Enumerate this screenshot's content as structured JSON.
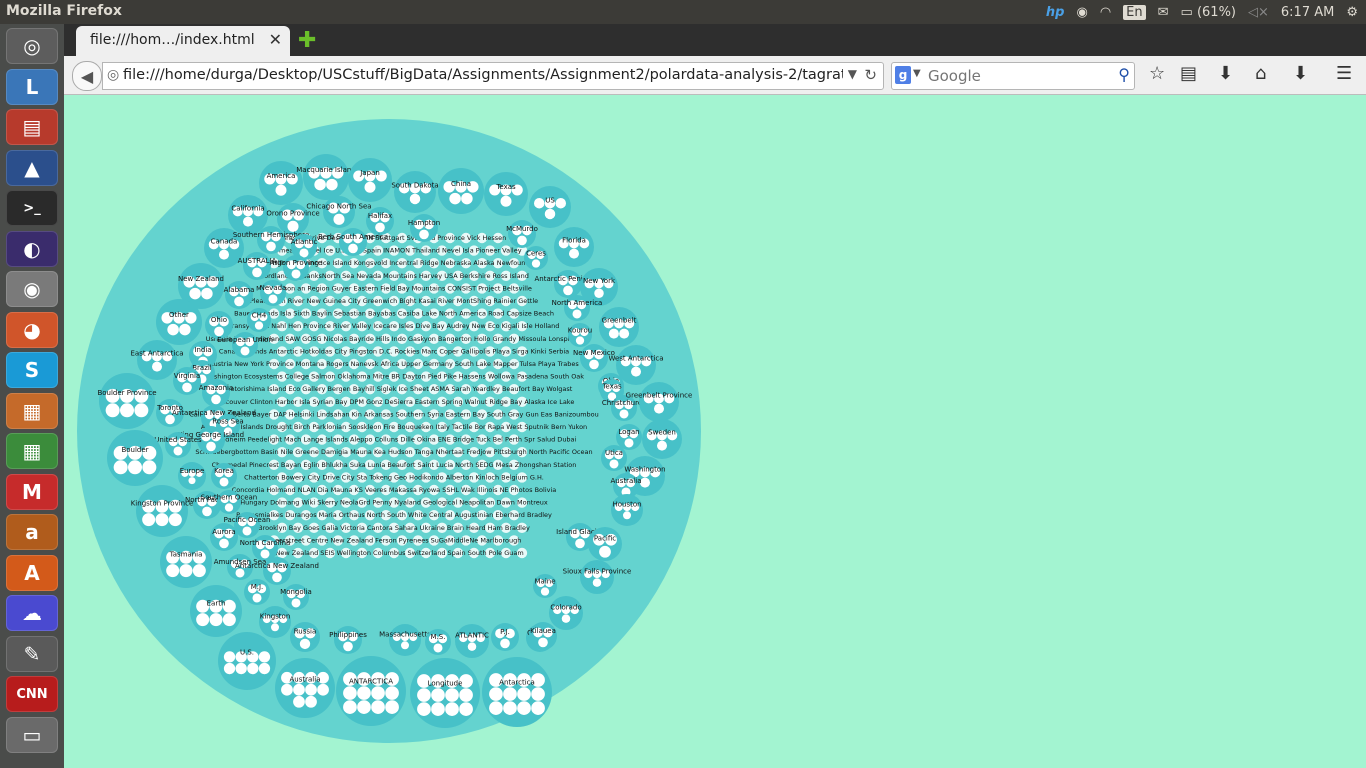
{
  "os": {
    "window_title": "Mozilla Firefox",
    "keyboard": "En",
    "battery": "(61%)",
    "clock": "6:17 AM"
  },
  "launcher": [
    {
      "name": "ubuntu-dash-icon",
      "glyph": "◎",
      "color": "#5d5d5d"
    },
    {
      "name": "libreoffice-icon",
      "glyph": "L",
      "color": "#3a76b8"
    },
    {
      "name": "files-icon",
      "glyph": "▤",
      "color": "#b73a2c"
    },
    {
      "name": "matlab-icon",
      "glyph": "▲",
      "color": "#2b4f8c"
    },
    {
      "name": "terminal-icon",
      "glyph": ">_",
      "color": "#2a2a2a"
    },
    {
      "name": "eclipse-icon",
      "glyph": "◐",
      "color": "#3a2c6c"
    },
    {
      "name": "chrome-icon",
      "glyph": "◉",
      "color": "#7a7a7a"
    },
    {
      "name": "firefox-icon",
      "glyph": "◕",
      "color": "#d0552a"
    },
    {
      "name": "skype-icon",
      "glyph": "S",
      "color": "#1a9ad6"
    },
    {
      "name": "impress-icon",
      "glyph": "▦",
      "color": "#c56a2a"
    },
    {
      "name": "calc-icon",
      "glyph": "▦",
      "color": "#3b8c3b"
    },
    {
      "name": "gmail-icon",
      "glyph": "M",
      "color": "#c62b2b"
    },
    {
      "name": "amazon-icon",
      "glyph": "a",
      "color": "#b05c1c"
    },
    {
      "name": "software-center-icon",
      "glyph": "A",
      "color": "#d35a1a"
    },
    {
      "name": "weather-icon",
      "glyph": "☁",
      "color": "#4a4ad0"
    },
    {
      "name": "viewer-icon",
      "glyph": "✎",
      "color": "#5a5a5a"
    },
    {
      "name": "cnn-icon",
      "glyph": "CNN",
      "color": "#b71c1c"
    },
    {
      "name": "disk-icon",
      "glyph": "▭",
      "color": "#6a6a6a"
    }
  ],
  "browser": {
    "tab_title": "file:///hom…/index.html",
    "url": "file:///home/durga/Desktop/USCstuff/BigData/Assignments/Assignment2/polardata-analysis-2/tagratio/ind",
    "search_placeholder": "Google"
  },
  "viz": {
    "nodes": [
      {
        "label": "America",
        "n": 4
      },
      {
        "label": "Macquarie Island",
        "n": 5
      },
      {
        "label": "Japan",
        "n": 4
      },
      {
        "label": "South Dakota",
        "n": 4
      },
      {
        "label": "China",
        "n": 5
      },
      {
        "label": "Texas",
        "n": 4
      },
      {
        "label": "US",
        "n": 4
      },
      {
        "label": "California",
        "n": 4
      },
      {
        "label": "Orono Province",
        "n": 3
      },
      {
        "label": "Chicago North Sea",
        "n": 3
      },
      {
        "label": "Halifax",
        "n": 3
      },
      {
        "label": "Hampton",
        "n": 3
      },
      {
        "label": "McMurdo",
        "n": 3
      },
      {
        "label": "Florida",
        "n": 4
      },
      {
        "label": "Canada",
        "n": 4
      },
      {
        "label": "Southern Hemisphere",
        "n": 3
      },
      {
        "label": "Atlantic",
        "n": 3
      },
      {
        "label": "Berb South America",
        "n": 3
      },
      {
        "label": "Ceres",
        "n": 3
      },
      {
        "label": "AUSTRALIA",
        "n": 3
      },
      {
        "label": "Argon Province",
        "n": 3
      },
      {
        "label": "New Zealand",
        "n": 5
      },
      {
        "label": "Alabama",
        "n": 3
      },
      {
        "label": "Nevada",
        "n": 3
      },
      {
        "label": "Antarctic Peninsula",
        "n": 3
      },
      {
        "label": "New York",
        "n": 4
      },
      {
        "label": "North America",
        "n": 3
      },
      {
        "label": "Other",
        "n": 5
      },
      {
        "label": "Ohio",
        "n": 3
      },
      {
        "label": "CH4",
        "n": 3
      },
      {
        "label": "Greenbelt",
        "n": 5
      },
      {
        "label": "Kourou",
        "n": 3
      },
      {
        "label": "European Union",
        "n": 3
      },
      {
        "label": "East Antarctica",
        "n": 4
      },
      {
        "label": "India",
        "n": 3
      },
      {
        "label": "New Mexico",
        "n": 3
      },
      {
        "label": "West Antarctica",
        "n": 4
      },
      {
        "label": "Brazil",
        "n": 3
      },
      {
        "label": "Virginia",
        "n": 3
      },
      {
        "label": "Amazonia",
        "n": 3
      },
      {
        "label": "Boulder Province",
        "n": 6
      },
      {
        "label": "Toronto",
        "n": 3
      },
      {
        "label": "Antarctica New Zealand",
        "n": 3
      },
      {
        "label": "Ross Sea",
        "n": 3
      },
      {
        "label": "Ohio",
        "n": 3
      },
      {
        "label": "Texas",
        "n": 3
      },
      {
        "label": "Christchurch",
        "n": 3
      },
      {
        "label": "Greenbelt Province",
        "n": 4
      },
      {
        "label": "King George Island",
        "n": 3
      },
      {
        "label": "United States",
        "n": 3
      },
      {
        "label": "Logan",
        "n": 3
      },
      {
        "label": "Sweden",
        "n": 4
      },
      {
        "label": "Boulder",
        "n": 6
      },
      {
        "label": "Utica",
        "n": 3
      },
      {
        "label": "Europe",
        "n": 4
      },
      {
        "label": "Korea",
        "n": 3
      },
      {
        "label": "Washington",
        "n": 4
      },
      {
        "label": "Australia",
        "n": 3
      },
      {
        "label": "Kingston Province",
        "n": 6
      },
      {
        "label": "North Pacific",
        "n": 3
      },
      {
        "label": "Southern Ocean",
        "n": 3
      },
      {
        "label": "Houston",
        "n": 4
      },
      {
        "label": "Aurora",
        "n": 3
      },
      {
        "label": "Pacific Ocean",
        "n": 3
      },
      {
        "label": "North Carolina",
        "n": 3
      },
      {
        "label": "Island Glacier",
        "n": 3
      },
      {
        "label": "Pacific",
        "n": 3
      },
      {
        "label": "Tasmania",
        "n": 6
      },
      {
        "label": "Amundsen Sea",
        "n": 3
      },
      {
        "label": "Antarctica New Zealand",
        "n": 3
      },
      {
        "label": "Sioux Falls Province",
        "n": 4
      },
      {
        "label": "Mongolia",
        "n": 3
      },
      {
        "label": "M.J.",
        "n": 3
      },
      {
        "label": "Maine",
        "n": 3
      },
      {
        "label": "Earth",
        "n": 6
      },
      {
        "label": "Colorado",
        "n": 4
      },
      {
        "label": "Kingston",
        "n": 4
      },
      {
        "label": "Russia",
        "n": 3
      },
      {
        "label": "Philippines",
        "n": 3
      },
      {
        "label": "Massachusetts",
        "n": 4
      },
      {
        "label": "M.S.",
        "n": 3
      },
      {
        "label": "ATLANTIC",
        "n": 4
      },
      {
        "label": "P.J.",
        "n": 3
      },
      {
        "label": "Oregon",
        "n": 3
      },
      {
        "label": "Kilauea",
        "n": 3
      },
      {
        "label": "U.S.",
        "n": 8
      },
      {
        "label": "Australia",
        "n": 10
      },
      {
        "label": "ANTARCTICA",
        "n": 12
      },
      {
        "label": "Longitude",
        "n": 12
      },
      {
        "label": "Antarctica",
        "n": 12
      }
    ],
    "dense_text": [
      "Brasilia Brive Desert OCEAN Stuttgart Svalbard Province Vick Hessen",
      "Warmea Bayagel Ice U.E.OMI Spain INAMON Thailand Nevel Isla Pioneer Valley",
      "Vestfold Hills Wyoming Ice Island Kongsvold Incentral Ridge Nebraska Alaska Newfoundland",
      "Fiordland FairbanksNorth Sea Nevada Mountains Harvey USA Berkshire Ross Island",
      "Milaskasson an Region Guyer Eastern Field Bay Mountains CONSIST Project Beltsville",
      "Pleasanton River New Guinea City Greenwich Bight Kasai River MontShing Rainier Gettle",
      "Bauer Islands Isla Sixth Baylin Sebastian Bayabas Casiba Lake North America Road Capsize Beach",
      "Transylvania Nahl Hen Province River Valley Icecare Isles Dive Bay Audrey New Eco Kigali Isle Holland",
      "Ushuaia Mal Borderland SAW GOSG Nicolas Bayride Hills Indo Gaskyon Bangerton Hollo Grandy Missoula Lonsphere",
      "Canary Islands Antarctic Hotkoldas City Pingston D.C. Rockies Marc Coper Gallipolis Playa Sirga Kinki Serbia",
      "Austria New York Province Montana Rogers Nanevsk Africa Upper Germany South Lake Mapper Tulsa Playa Trabes",
      "Washington Ecosystems College Salmon Oklahoma Mitre BR Dayton Pied Pike Hassens Wollowa Pasadena South Oak",
      "Okinotorishima Island Eco Gallery Bergen Bayhill Siglek Ice Sheet ASMA Sarah Yeardley Beaufort Bay Wolgast",
      "Vancouver Clinton Harbor Isla Syrian Bay DPM Gonz DeSierra Eastern Spring Walnut Ridge Bay Alaska Ice Lake",
      "Calif Diego Alberta Bayer DAP Helsinki Lindsahan Kin Arkansas Southern Syria Eastern Bay South Gray Gun Eas Banizoumbou",
      "Amsterdam Islands Drought Birch Parklonian Sooskleon Fire Bouqueken Italy Tactile Bor Rapa West Sputnik Bern Yukon",
      "Trondheim Peedelight Mach Lange Islands Aleppo Colluns Dille Okina ENE Bridge Tuck Bel Perth Spr Salud Dubai",
      "Schwaebergbottom Basin Nile Greene Damigia Mauna Kea Hudson Tanga Nhertaat Fredjow Pittsburgh North Pacific Ocean",
      "Chromedal Pinecrest Bayan Eglin Bhlukha Suka Lunia Beaufort Saint Lucia North SEDG Mesa Zhongshan Station",
      "Chatterton Bowery City Drive City Sta Tokeng Geo Hodikondo Alberton Kinloch Belgium G.H.",
      "Concordia Holmand NLAN Dia Mauna KS Veeres Makassa Ryowa SSHL Wak Illinois NE Photos Bolivia",
      "Hungary Dolmang Wiki Skerry NeolaGrd Penny Nyaland Geological Neapolitan Dawn Montreux",
      "Boemsmialkes Durangos Maria Orthaus North South White Central Augustinian Eberhard Bradley",
      "Brooklyn Bay Goes Galia Victoria Cantora Sahara Ukraine Brain Heard Ham Bradley",
      "Sheerstreet Centre New Zealand Ferson Pyrenees SuGaMiddleNe Marlborough",
      "Tiji New Zealand SEIS Wellington Columbus Switzerland Spain South Pole Guam"
    ]
  }
}
